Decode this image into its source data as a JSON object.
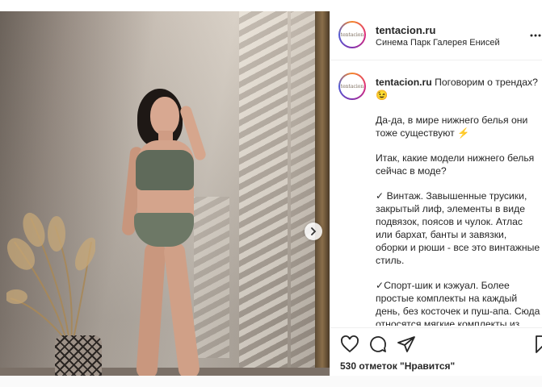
{
  "post": {
    "username": "tentacion.ru",
    "location": "Синема Парк Галерея Енисей",
    "avatar_text": "tentacion",
    "caption": {
      "intro": "Поговорим о трендах? 😉",
      "p1": "Да-да, в мире нижнего белья они тоже существуют ⚡",
      "p2": "Итак, какие модели нижнего белья сейчас в моде?",
      "p3": "✓ Винтаж. Завышенные трусики, закрытый лиф, элементы в виде подвязок, поясов и чулок. Атлас или бархат, банты и завязки, оборки и рюши - все это винтажные стиль.",
      "p4": "✓Спорт-шик и кэжуал. Более простые комплекты на каждый день, без косточек и пуш-апа. Сюда относятся мягкие комплекты из простой ткани, а также комплекты"
    },
    "likes": "530 отметок \"Нравится\"",
    "icons": [
      "heart-icon",
      "comment-icon",
      "share-icon",
      "bookmark-icon",
      "chevron-right-icon",
      "more-icon"
    ]
  }
}
